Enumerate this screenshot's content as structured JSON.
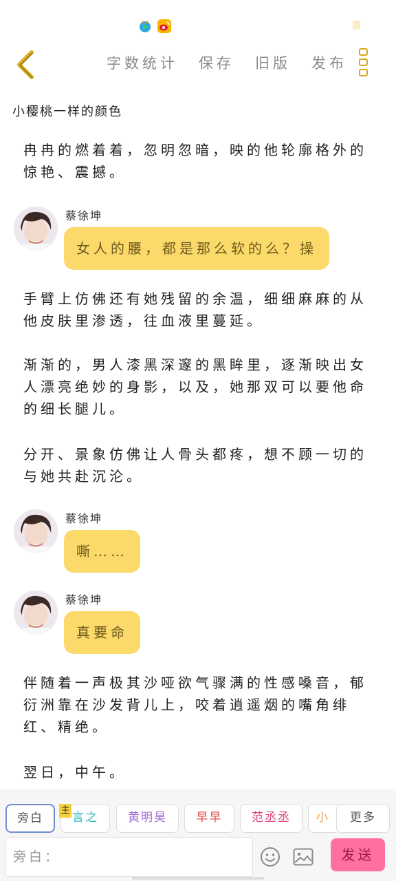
{
  "header": {
    "menu": [
      "字数统计",
      "保存",
      "旧版",
      "发布"
    ]
  },
  "story_title": "小樱桃一样的颜色",
  "content": {
    "para1": "冉冉的燃着着，忽明忽暗，映的他轮廓格外的惊艳、震撼。",
    "msg1": {
      "speaker": "蔡徐坤",
      "text": "女人的腰，都是那么软的么？操"
    },
    "para2": "手臂上仿佛还有她残留的余温，细细麻麻的从他皮肤里渗透，往血液里蔓延。",
    "para3": "渐渐的，男人漆黑深邃的黑眸里，逐渐映出女人漂亮绝妙的身影，以及，她那双可以要他命的细长腿儿。",
    "para4": "分开、景象仿佛让人骨头都疼，想不顾一切的与她共赴沉沦。",
    "msg2": {
      "speaker": "蔡徐坤",
      "text": "嘶……"
    },
    "msg3": {
      "speaker": "蔡徐坤",
      "text": "真要命"
    },
    "para5": "伴随着一声极其沙哑欲气骤满的性感嗓音，郁衍洲靠在沙发背儿上，咬着逍遥烟的嘴角绯红、精绝。",
    "para6": "翌日，中午。"
  },
  "characters": {
    "narration": "旁白",
    "main_tag": "主",
    "list": [
      {
        "name": "言之",
        "color": "#2bb3c0"
      },
      {
        "name": "黄明昊",
        "color": "#a46ad6"
      },
      {
        "name": "早早",
        "color": "#e44d4d"
      },
      {
        "name": "范丞丞",
        "color": "#e0407e"
      },
      {
        "name": "小",
        "color": "#f0a24a"
      }
    ],
    "more": "更多"
  },
  "input": {
    "placeholder": "旁白："
  },
  "send_label": "发送",
  "colors": {
    "accent": "#d9a81c",
    "bubble": "#fbd96a",
    "send": "#ff6fa0"
  }
}
